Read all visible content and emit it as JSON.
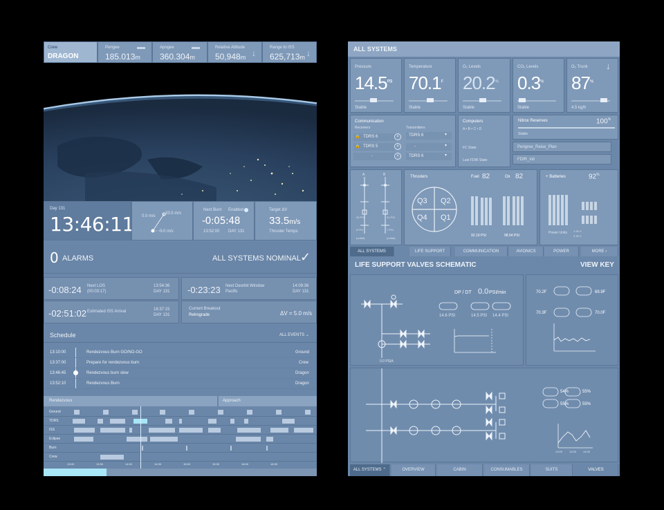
{
  "left": {
    "header": {
      "crew_label": "Crew",
      "crew_value": "DRAGON",
      "perigee_label": "Perigee",
      "perigee_value": "185.013",
      "perigee_unit": "m",
      "apogee_label": "Apogee",
      "apogee_value": "360.304",
      "apogee_unit": "m",
      "rel_alt_label": "Relative Altitude",
      "rel_alt_value": "50,948",
      "rel_alt_unit": "m",
      "range_label": "Range to ISS",
      "range_value": "625,713",
      "range_unit": "m"
    },
    "clock": {
      "day_label": "Day 131",
      "time": "13:46:11",
      "vel_top": "33.5",
      "vel_top_unit": "m/s",
      "vel_left": "0.0",
      "vel_left_unit": "m/s",
      "vel_bottom": "0.0",
      "vel_bottom_unit": "m/s",
      "next_burn_label": "Next Burn",
      "enabled_label": "Enabled",
      "next_burn_value": "-0:05:48",
      "next_burn_time": "13:52:00",
      "next_burn_day": "DAY 131",
      "target_label": "Target ΔV",
      "target_value": "33.5",
      "target_unit": "m/s",
      "thruster_label": "Thruster Temps"
    },
    "alarms": {
      "count": "0",
      "label": "ALARMS",
      "status": "ALL SYSTEMS NOMINAL"
    },
    "events": [
      {
        "countdown": "-0:08:24",
        "name": "Next LOS",
        "sub": "(00:03:17)",
        "time": "13:54:36",
        "day": "DAY 131"
      },
      {
        "countdown": "-0:23:23",
        "name": "Next Deorbit Window",
        "sub": "Pacific",
        "time": "14:09:36",
        "day": "DAY 131"
      },
      {
        "countdown": "-02:51:02",
        "name": "Estimated ISS Arrival",
        "sub": "",
        "time": "16:37:15",
        "day": "DAY 131"
      }
    ],
    "breakout": {
      "label": "Current Breakout",
      "value": "Retrograde",
      "dv": "ΔV = 5.0 m/s"
    },
    "schedule": {
      "title": "Schedule",
      "filter": "ALL EVENTS",
      "rows": [
        {
          "time": "13:10:00",
          "event": "Rendezvous Burn GO/NO-GO",
          "owner": "Ground"
        },
        {
          "time": "13:37:00",
          "event": "Prepare for rendezvous burn",
          "owner": "Crew"
        },
        {
          "time": "13:46:45",
          "event": "Rendezvous burn slow",
          "owner": "Dragon"
        },
        {
          "time": "13:52:10",
          "event": "Rendezvous Burn",
          "owner": "Dragon"
        }
      ]
    },
    "timeline": {
      "phase1": "Rendezvous",
      "phase2": "Approach",
      "rows": [
        "Ground",
        "TDRS",
        "ISS",
        "Eclipse",
        "Burn",
        "Crew"
      ],
      "ticks": [
        "13:00",
        "13:30",
        "14:00",
        "14:30",
        "15:00",
        "15:30",
        "16:00",
        "16:30"
      ],
      "progress": 0.23
    }
  },
  "right": {
    "title": "ALL SYSTEMS",
    "metrics": [
      {
        "label": "Pressure",
        "value": "14.5",
        "unit": "PSI",
        "status": "Stable"
      },
      {
        "label": "Temperature",
        "value": "70.1",
        "unit": "F",
        "status": "Stable"
      },
      {
        "label": "O₂ Levels",
        "value": "20.2",
        "unit": "%",
        "status": "Stable"
      },
      {
        "label": "CO₂ Levels",
        "value": "0.3",
        "unit": "%",
        "status": "Stable"
      },
      {
        "label": "O₂ Trunk",
        "value": "87",
        "unit": "%",
        "status": "4.5 kg/h"
      }
    ],
    "comm": {
      "title": "Communication",
      "receivers": "Receivers",
      "transmitters": "Transmitters",
      "rx": [
        "TDRS 6",
        "TDRS 5",
        "-"
      ],
      "tx": [
        "TDRS 6",
        "-",
        "TDRS 6"
      ]
    },
    "computers": {
      "title": "Computers",
      "sub": "A • B • C • D",
      "fc_label": "FC State",
      "fc_value": "Perigree_Raise_Plan",
      "fdir_label": "Last FDIR State",
      "fdir_value": "FDIR_init"
    },
    "nitrox": {
      "title": "Nitrox Reserves",
      "value": "100",
      "unit": "%",
      "status": "Stable"
    },
    "thrusters": {
      "title": "Thrusters",
      "quads": [
        "Q3",
        "Q2",
        "Q4",
        "Q1"
      ],
      "fuel_label": "Fuel",
      "fuel_value": "82",
      "ox_label": "Ox",
      "ox_value": "82",
      "fuel_psi": "92.19 PSI",
      "ox_psi": "98.04 PSI"
    },
    "valves_small": {
      "labels": [
        "A",
        "B"
      ],
      "psi_a": "26 PSI",
      "psi_b": "31 PSI",
      "psi_a2": "6 PSI",
      "psi_b2": "7 PSI",
      "sub_a": "(outlet)",
      "sub_b": "(outlet)"
    },
    "batteries": {
      "title": "Batteries",
      "value": "92",
      "unit": "%",
      "power_label": "Power Units",
      "units": [
        "1  20 V",
        "2  20 V"
      ]
    },
    "tabs_top": [
      "ALL SYSTEMS",
      "LIFE SUPPORT",
      "COMMUNICATION",
      "AVIONICS",
      "POWER",
      "MORE"
    ],
    "schematic": {
      "title": "LIFE SUPPORT VALVES SCHEMATIC",
      "view_key": "VIEW KEY",
      "dpdt_label": "DP / DT",
      "dpdt_value": "0.0",
      "dpdt_unit": "PSI/min",
      "psi_readouts": [
        "14.6 PSI",
        "14.5 PSI",
        "14.4 PSI"
      ],
      "cabin_pos": "0.0 PSIA",
      "temps_left": [
        "70.2F",
        "70.3F"
      ],
      "temps_right": [
        "69.9F",
        "70.0F"
      ],
      "pcts": [
        "54%",
        "55%",
        "55%",
        "55%"
      ],
      "chart_ticks": [
        "13:00",
        "13:30",
        "14:00"
      ]
    },
    "tabs_bottom": [
      "ALL SYSTEMS",
      "OVERVIEW",
      "CABIN",
      "CONSUMABLES",
      "SUITS",
      "VALVES"
    ]
  }
}
